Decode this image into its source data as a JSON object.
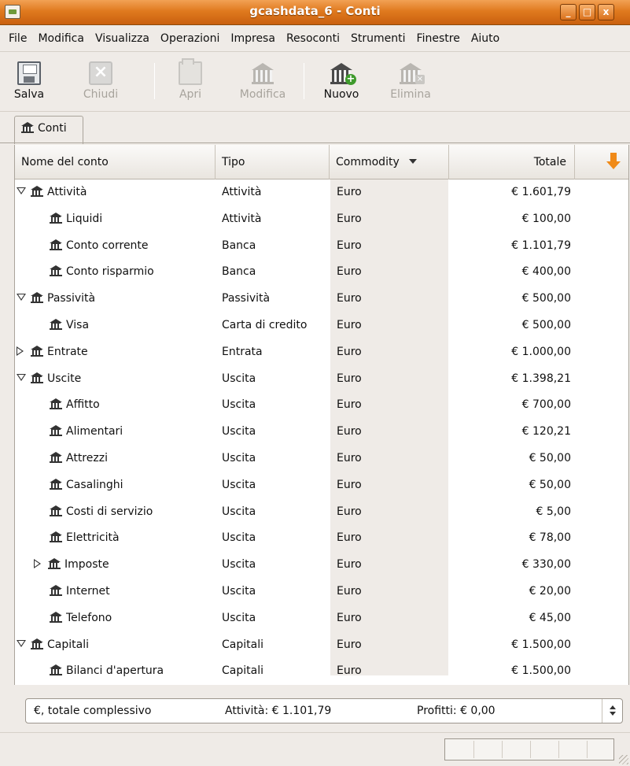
{
  "window": {
    "title": "gcashdata_6 - Conti",
    "buttons": [
      "_",
      "□",
      "x"
    ]
  },
  "menu": [
    {
      "label": "File"
    },
    {
      "label": "Modifica"
    },
    {
      "label": "Visualizza"
    },
    {
      "label": "Operazioni"
    },
    {
      "label": "Impresa"
    },
    {
      "label": "Resoconti"
    },
    {
      "label": "Strumenti"
    },
    {
      "label": "Finestre"
    },
    {
      "label": "Aiuto"
    }
  ],
  "toolbar": {
    "save": "Salva",
    "close": "Chiudi",
    "open": "Apri",
    "edit": "Modifica",
    "new": "Nuovo",
    "delete": "Elimina"
  },
  "tab": {
    "label": "Conti"
  },
  "columns": {
    "name": "Nome del conto",
    "type": "Tipo",
    "commodity": "Commodity",
    "total": "Totale"
  },
  "accounts": [
    {
      "name": "Attività",
      "type": "Attività",
      "commodity": "Euro",
      "total": "€ 1.601,79",
      "level": 0,
      "expander": "open"
    },
    {
      "name": "Liquidi",
      "type": "Attività",
      "commodity": "Euro",
      "total": "€ 100,00",
      "level": 1,
      "expander": "none"
    },
    {
      "name": "Conto corrente",
      "type": "Banca",
      "commodity": "Euro",
      "total": "€ 1.101,79",
      "level": 1,
      "expander": "none"
    },
    {
      "name": "Conto risparmio",
      "type": "Banca",
      "commodity": "Euro",
      "total": "€ 400,00",
      "level": 1,
      "expander": "none"
    },
    {
      "name": "Passività",
      "type": "Passività",
      "commodity": "Euro",
      "total": "€ 500,00",
      "level": 0,
      "expander": "open"
    },
    {
      "name": "Visa",
      "type": "Carta di credito",
      "commodity": "Euro",
      "total": "€ 500,00",
      "level": 1,
      "expander": "none"
    },
    {
      "name": "Entrate",
      "type": "Entrata",
      "commodity": "Euro",
      "total": "€ 1.000,00",
      "level": 0,
      "expander": "closed"
    },
    {
      "name": "Uscite",
      "type": "Uscita",
      "commodity": "Euro",
      "total": "€ 1.398,21",
      "level": 0,
      "expander": "open"
    },
    {
      "name": "Affitto",
      "type": "Uscita",
      "commodity": "Euro",
      "total": "€ 700,00",
      "level": 1,
      "expander": "none"
    },
    {
      "name": "Alimentari",
      "type": "Uscita",
      "commodity": "Euro",
      "total": "€ 120,21",
      "level": 1,
      "expander": "none"
    },
    {
      "name": "Attrezzi",
      "type": "Uscita",
      "commodity": "Euro",
      "total": "€ 50,00",
      "level": 1,
      "expander": "none"
    },
    {
      "name": "Casalinghi",
      "type": "Uscita",
      "commodity": "Euro",
      "total": "€ 50,00",
      "level": 1,
      "expander": "none"
    },
    {
      "name": "Costi di servizio",
      "type": "Uscita",
      "commodity": "Euro",
      "total": "€ 5,00",
      "level": 1,
      "expander": "none"
    },
    {
      "name": "Elettricità",
      "type": "Uscita",
      "commodity": "Euro",
      "total": "€ 78,00",
      "level": 1,
      "expander": "none"
    },
    {
      "name": "Imposte",
      "type": "Uscita",
      "commodity": "Euro",
      "total": "€ 330,00",
      "level": 1,
      "expander": "closed"
    },
    {
      "name": "Internet",
      "type": "Uscita",
      "commodity": "Euro",
      "total": "€ 20,00",
      "level": 1,
      "expander": "none"
    },
    {
      "name": "Telefono",
      "type": "Uscita",
      "commodity": "Euro",
      "total": "€ 45,00",
      "level": 1,
      "expander": "none"
    },
    {
      "name": "Capitali",
      "type": "Capitali",
      "commodity": "Euro",
      "total": "€ 1.500,00",
      "level": 0,
      "expander": "open"
    },
    {
      "name": "Bilanci d'apertura",
      "type": "Capitali",
      "commodity": "Euro",
      "total": "€ 1.500,00",
      "level": 1,
      "expander": "none"
    }
  ],
  "summary": {
    "currency": "€, totale complessivo",
    "assets": "Attività: € 1.101,79",
    "profits": "Profitti: € 0,00"
  },
  "colors": {
    "titlebar": "#e07a1e",
    "commodity_column": "#efebe7",
    "sort_arrow": "#f08a18"
  }
}
